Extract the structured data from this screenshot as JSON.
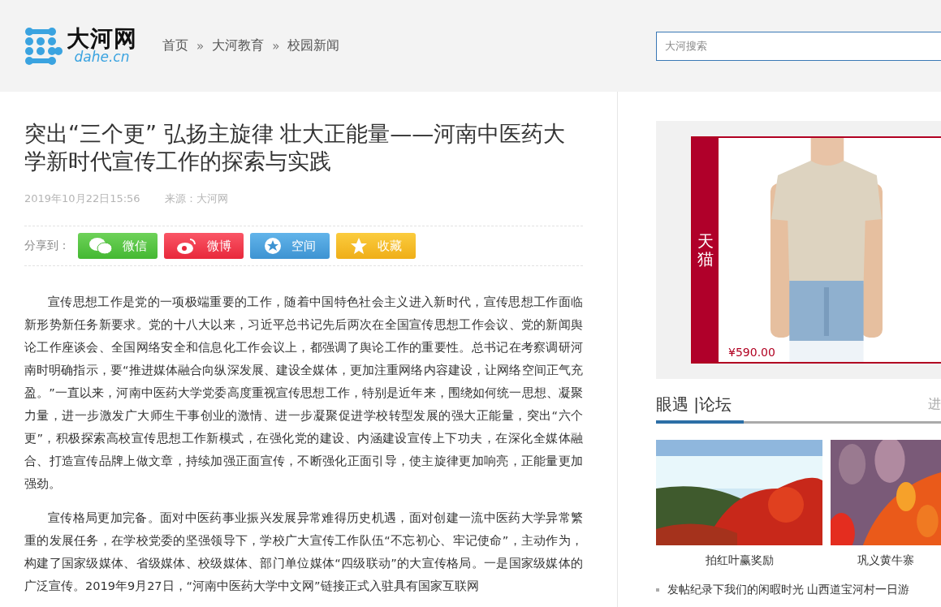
{
  "header": {
    "logo": {
      "name": "大河网",
      "domain": "dahe.cn"
    },
    "breadcrumbs": [
      {
        "label": "首页"
      },
      {
        "label": "大河教育"
      },
      {
        "label": "校园新闻"
      }
    ],
    "separator": "»",
    "search": {
      "placeholder": "大河搜索"
    }
  },
  "article": {
    "title": "突出“三个更” 弘扬主旋律 壮大正能量——河南中医药大学新时代宣传工作的探索与实践",
    "date": "2019年10月22日15:56",
    "source": "来源：大河网",
    "share": {
      "label": "分享到：",
      "buttons": [
        {
          "label": "微信",
          "kind": "wechat"
        },
        {
          "label": "微博",
          "kind": "weibo"
        },
        {
          "label": "空间",
          "kind": "qzone"
        },
        {
          "label": "收藏",
          "kind": "favorite"
        }
      ]
    },
    "paragraphs": [
      "宣传思想工作是党的一项极端重要的工作，随着中国特色社会主义进入新时代，宣传思想工作面临新形势新任务新要求。党的十八大以来，习近平总书记先后两次在全国宣传思想工作会议、党的新闻舆论工作座谈会、全国网络安全和信息化工作会议上，都强调了舆论工作的重要性。总书记在考察调研河南时明确指示，要“推进媒体融合向纵深发展、建设全媒体，更加注重网络内容建设，让网络空间正气充盈。”一直以来，河南中医药大学党委高度重视宣传思想工作，特别是近年来，围绕如何统一思想、凝聚力量，进一步激发广大师生干事创业的激情、进一步凝聚促进学校转型发展的强大正能量，突出“六个更”，积极探索高校宣传思想工作新模式，在强化党的建设、内涵建设宣传上下功夫，在深化全媒体融合、打造宣传品牌上做文章，持续加强正面宣传，不断强化正面引导，使主旋律更加响亮，正能量更加强劲。",
      "宣传格局更加完备。面对中医药事业振兴发展异常难得历史机遇，面对创建一流中医药大学异常繁重的发展任务，在学校党委的坚强领导下，学校广大宣传工作队伍“不忘初心、牢记使命”，主动作为，构建了国家级媒体、省级媒体、校级媒体、部门单位媒体“四级联动”的大宣传格局。一是国家级媒体的广泛宣传。2019年9月27日，“河南中医药大学中文网”链接正式入驻具有国家互联网"
    ]
  },
  "sidebar": {
    "ad": {
      "badge": "天猫",
      "price": "¥590.00"
    },
    "forum": {
      "title": "眼遇 |论坛",
      "more": "进",
      "photos": [
        {
          "caption": "拍红叶赢奖励",
          "kind": "hill"
        },
        {
          "caption": "巩义黄牛寨",
          "kind": "leaves"
        }
      ],
      "links": [
        "发帖纪录下我们的闲暇时光 山西道宝河村一日游"
      ]
    }
  }
}
